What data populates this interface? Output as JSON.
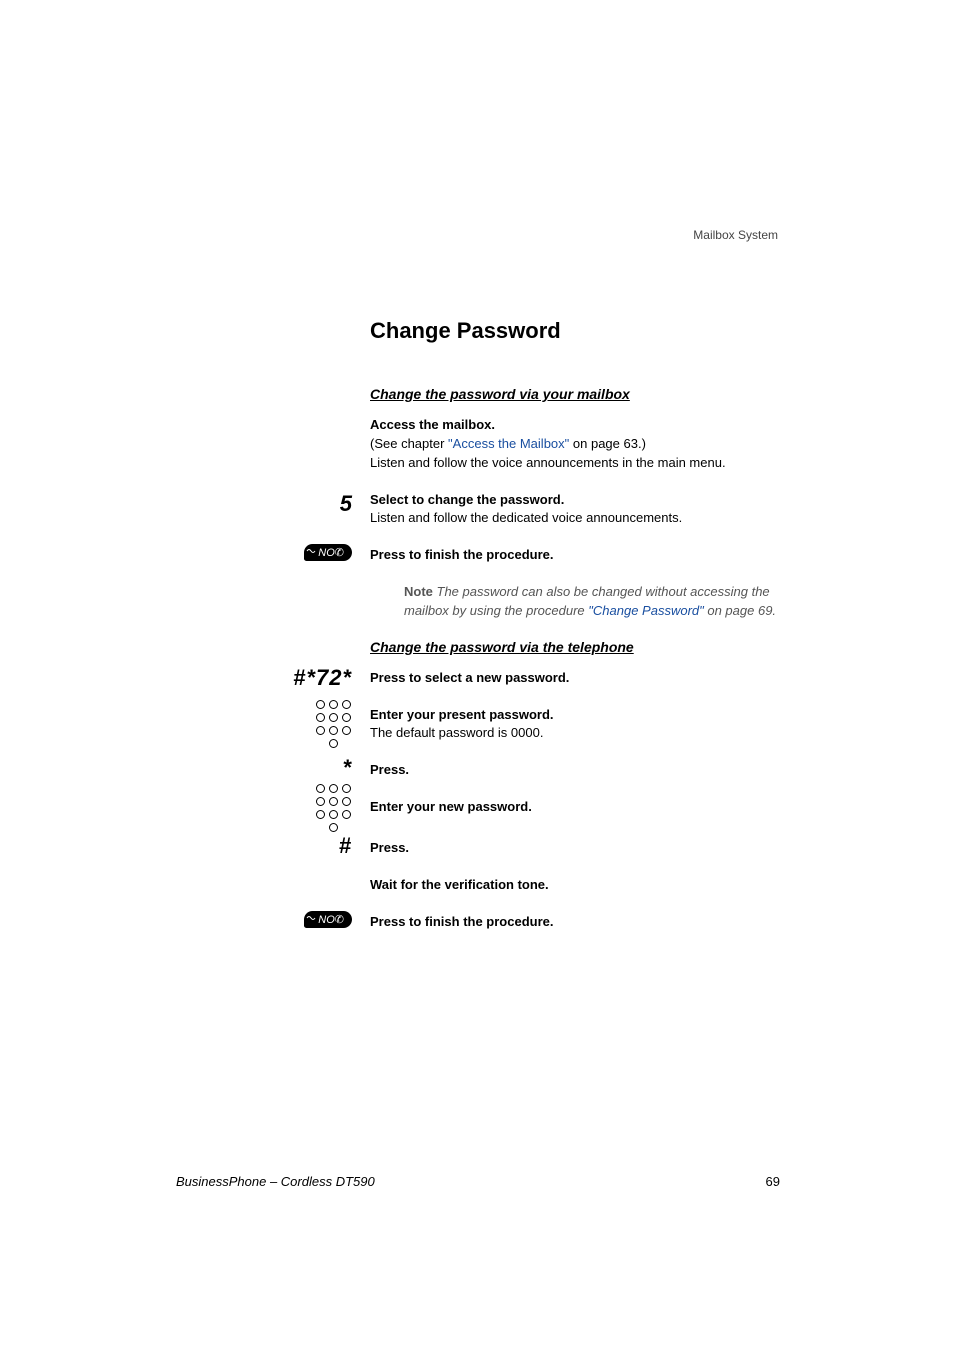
{
  "header": {
    "section": "Mailbox System"
  },
  "title": "Change Password",
  "section1": {
    "heading": "Change the password via your mailbox",
    "step1": {
      "bold": "Access the mailbox.",
      "line1_pre": "(See chapter ",
      "link": "\"Access the Mailbox\"",
      "line1_post": " on page 63.)",
      "line2": "Listen and follow the voice announcements in the main menu."
    },
    "step2": {
      "key": "5",
      "bold": "Select to change the password.",
      "line": "Listen and follow the dedicated voice announcements."
    },
    "step3": {
      "button": "NO",
      "bold": "Press to finish the procedure."
    },
    "note": {
      "label": "Note",
      "text_pre": " The password can also be changed without accessing the mailbox by using the procedure ",
      "link": "\"Change Password\"",
      "text_post": " on page 69."
    }
  },
  "section2": {
    "heading": "Change the password via the telephone",
    "step1": {
      "key": "#*72*",
      "bold": "Press to select a new password."
    },
    "step2": {
      "bold": "Enter your present password.",
      "line": "The default password is 0000."
    },
    "step3": {
      "key": "*",
      "bold": "Press."
    },
    "step4": {
      "bold": "Enter your new password."
    },
    "step5": {
      "key": "#",
      "bold": "Press."
    },
    "step6": {
      "bold": "Wait for the verification tone."
    },
    "step7": {
      "button": "NO",
      "bold": "Press to finish the procedure."
    }
  },
  "footer": {
    "left": "BusinessPhone – Cordless DT590",
    "right": "69"
  }
}
